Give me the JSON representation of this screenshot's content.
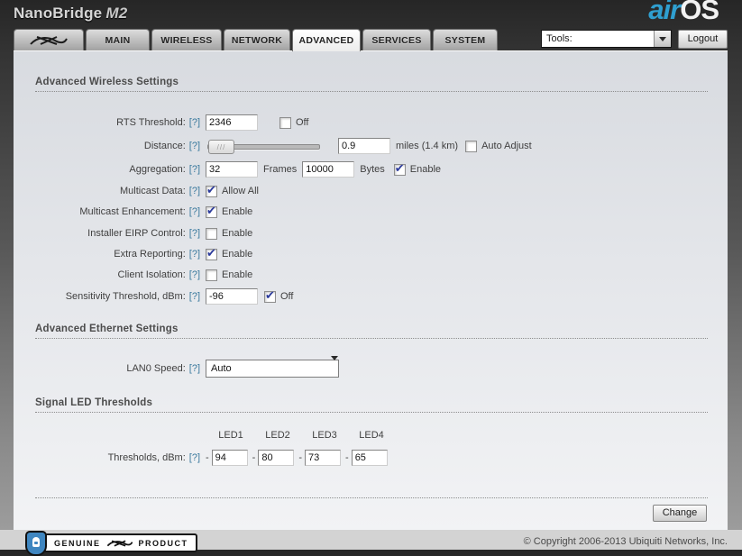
{
  "header": {
    "device_name": "NanoBridge",
    "device_model": "M2",
    "brand_air": "air",
    "brand_os": "OS"
  },
  "tabbar": {
    "tabs": [
      {
        "label": "MAIN"
      },
      {
        "label": "WIRELESS"
      },
      {
        "label": "NETWORK"
      },
      {
        "label": "ADVANCED"
      },
      {
        "label": "SERVICES"
      },
      {
        "label": "SYSTEM"
      }
    ],
    "active_tab": "ADVANCED",
    "tools_label": "Tools:",
    "logout_label": "Logout"
  },
  "help_mark": "[?]",
  "wireless": {
    "title": "Advanced Wireless Settings",
    "rts": {
      "label": "RTS Threshold:",
      "value": "2346",
      "off_label": "Off",
      "off_checked": false
    },
    "distance": {
      "label": "Distance:",
      "value": "0.9",
      "unit": "miles (1.4 km)",
      "auto_label": "Auto Adjust",
      "auto_checked": false,
      "slider_hatch": "///"
    },
    "aggregation": {
      "label": "Aggregation:",
      "frames_value": "32",
      "frames_label": "Frames",
      "bytes_value": "10000",
      "bytes_label": "Bytes",
      "enable_label": "Enable",
      "enable_checked": true
    },
    "multicast_data": {
      "label": "Multicast Data:",
      "checkbox_label": "Allow All",
      "checked": true
    },
    "multicast_enhancement": {
      "label": "Multicast Enhancement:",
      "checkbox_label": "Enable",
      "checked": true
    },
    "installer_eirp": {
      "label": "Installer EIRP Control:",
      "checkbox_label": "Enable",
      "checked": false
    },
    "extra_reporting": {
      "label": "Extra Reporting:",
      "checkbox_label": "Enable",
      "checked": true
    },
    "client_isolation": {
      "label": "Client Isolation:",
      "checkbox_label": "Enable",
      "checked": false
    },
    "sensitivity": {
      "label": "Sensitivity Threshold, dBm:",
      "value": "-96",
      "off_label": "Off",
      "off_checked": true
    }
  },
  "ethernet": {
    "title": "Advanced Ethernet Settings",
    "lan0": {
      "label": "LAN0 Speed:",
      "value": "Auto"
    }
  },
  "led": {
    "title": "Signal LED Thresholds",
    "thresholds_label": "Thresholds, dBm:",
    "columns": [
      "LED1",
      "LED2",
      "LED3",
      "LED4"
    ],
    "values": [
      "94",
      "80",
      "73",
      "65"
    ],
    "separator": "-"
  },
  "footer": {
    "change_label": "Change",
    "copyright": "© Copyright 2006-2013 Ubiquiti Networks, Inc.",
    "badge_genuine": "GENUINE",
    "badge_product": "PRODUCT"
  },
  "colors": {
    "accent_blue": "#2f9fd0",
    "help_link": "#3b7a9e",
    "check_blue": "#2b3a9c"
  }
}
